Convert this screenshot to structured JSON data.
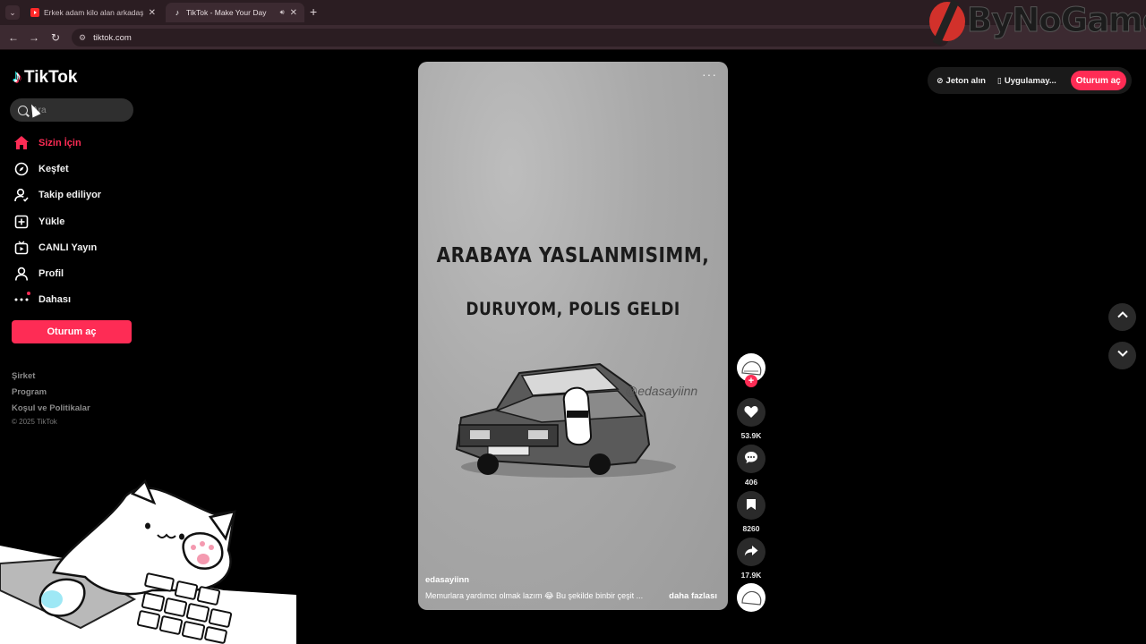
{
  "browser": {
    "tabs": [
      {
        "title": "Erkek adam kilo alan arkadaşını",
        "favicon": "youtube-icon"
      },
      {
        "title": "TikTok - Make Your Day",
        "favicon": "tiktok-icon"
      }
    ],
    "url": "tiktok.com"
  },
  "watermark": {
    "text": "ByNoGame"
  },
  "brand": {
    "name": "TikTok"
  },
  "search": {
    "placeholder": "Ara"
  },
  "sidebar": {
    "items": [
      {
        "label": "Sizin İçin",
        "icon": "home-icon"
      },
      {
        "label": "Keşfet",
        "icon": "compass-icon"
      },
      {
        "label": "Takip ediliyor",
        "icon": "following-icon"
      },
      {
        "label": "Yükle",
        "icon": "upload-icon"
      },
      {
        "label": "CANLI Yayın",
        "icon": "live-icon"
      },
      {
        "label": "Profil",
        "icon": "profile-icon"
      },
      {
        "label": "Dahası",
        "icon": "more-icon"
      }
    ],
    "login_label": "Oturum aç",
    "footer_links": [
      "Şirket",
      "Program",
      "Koşul ve Politikalar"
    ],
    "copyright": "© 2025 TikTok"
  },
  "topbar": {
    "coins_label": "Jeton alın",
    "app_label": "Uygulamay...",
    "login_label": "Oturum aç"
  },
  "video": {
    "line1": "ARABAYA YASLANMISIMM,",
    "line2": "DURUYOM, POLIS GELDI",
    "watermark_handle": "@edasayiinn",
    "author": "edasayiinn",
    "description": "Memurlara yardımcı olmak lazım 😂 Bu şekilde binbir çeşit ...",
    "more_label": "daha fazlası"
  },
  "actions": {
    "likes": "53.9K",
    "comments": "406",
    "saves": "8260",
    "shares": "17.9K"
  },
  "colors": {
    "accent": "#fe2c55",
    "background": "#000000"
  }
}
